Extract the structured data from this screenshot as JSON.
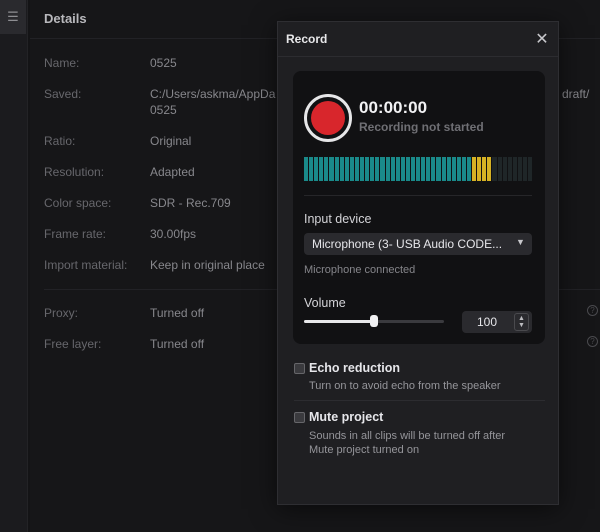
{
  "details": {
    "title": "Details",
    "rows": [
      {
        "label": "Name:",
        "value": "0525"
      },
      {
        "label": "Saved:",
        "value": "C:/Users/askma/AppDa"
      },
      {
        "label": "Ratio:",
        "value": "Original"
      },
      {
        "label": "Resolution:",
        "value": "Adapted"
      },
      {
        "label": "Color space:",
        "value": "SDR - Rec.709"
      },
      {
        "label": "Frame rate:",
        "value": "30.00fps"
      },
      {
        "label": "Import material:",
        "value": "Keep in original place"
      },
      {
        "label": "Proxy:",
        "value": "Turned off"
      },
      {
        "label": "Free layer:",
        "value": "Turned off"
      }
    ],
    "saved_value_line2": "0525",
    "saved_value_tail": "draft/"
  },
  "dialog": {
    "title": "Record",
    "timer": "00:00:00",
    "status": "Recording not started",
    "input_device_label": "Input device",
    "input_device_value": "Microphone (3- USB Audio CODE...",
    "mic_status": "Microphone connected",
    "volume_label": "Volume",
    "volume_value": "100",
    "volume_slider_fraction": 0.5,
    "meter": {
      "total_bars": 45,
      "active_bars": 37,
      "peak_start": 33,
      "peak_end": 37
    },
    "echo_reduction": {
      "title": "Echo reduction",
      "description": "Turn on to avoid echo from the speaker",
      "checked": false
    },
    "mute_project": {
      "title": "Mute project",
      "description": "Sounds in all clips will be turned off after Mute project turned on",
      "checked": false
    }
  },
  "colors": {
    "record_red": "#d8262c",
    "meter_teal": "#1a8a8a",
    "meter_peak": "#d6b224",
    "meter_idle": "#1f2628"
  }
}
